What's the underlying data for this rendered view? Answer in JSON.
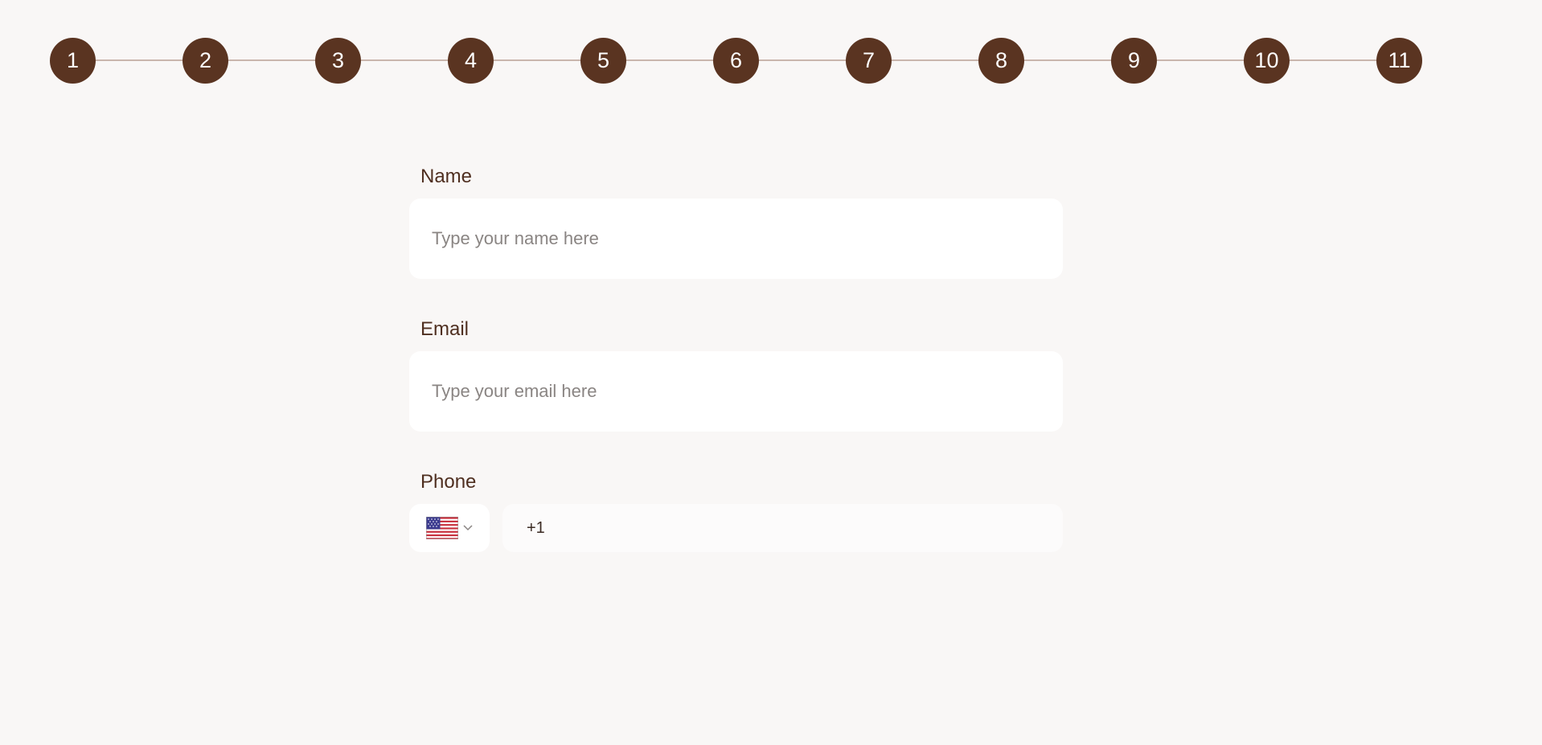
{
  "stepper": {
    "steps": [
      "1",
      "2",
      "3",
      "4",
      "5",
      "6",
      "7",
      "8",
      "9",
      "10",
      "11"
    ]
  },
  "form": {
    "name": {
      "label": "Name",
      "placeholder": "Type your name here",
      "value": ""
    },
    "email": {
      "label": "Email",
      "placeholder": "Type your email here",
      "value": ""
    },
    "phone": {
      "label": "Phone",
      "country_icon": "us-flag-icon",
      "value": "+1"
    }
  },
  "colors": {
    "accent": "#5a3421",
    "background": "#f9f7f6",
    "label_text": "#4f2f20",
    "connector_line": "#c9b6ad"
  }
}
